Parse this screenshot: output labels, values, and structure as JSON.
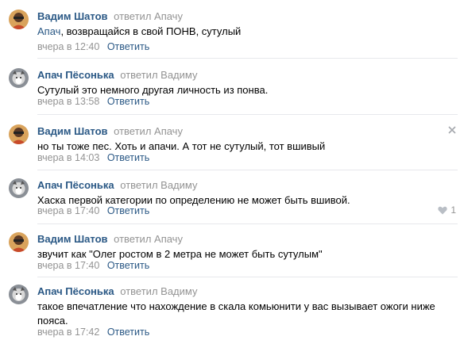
{
  "comments": [
    {
      "author": "Вадим Шатов",
      "replied": "ответил",
      "reply_to": "Апачу",
      "mention": "Апач",
      "text": ", возвращайся в свой ПОНВ, сутулый",
      "date": "вчера в 12:40",
      "reply_label": "Ответить",
      "avatar": "vadim-avatar"
    },
    {
      "author": "Апач Пёсонька",
      "replied": "ответил",
      "reply_to": "Вадиму",
      "text": "Сутулый это немного другая личность из понва.",
      "date": "вчера в 13:58",
      "reply_label": "Ответить",
      "avatar": "apach-avatar"
    },
    {
      "author": "Вадим Шатов",
      "replied": "ответил",
      "reply_to": "Апачу",
      "text": "но ты тоже пес. Хоть и апачи. А тот не сутулый, тот вшивый",
      "date": "вчера в 14:03",
      "reply_label": "Ответить",
      "avatar": "vadim-avatar",
      "close_icon": "close-icon"
    },
    {
      "author": "Апач Пёсонька",
      "replied": "ответил",
      "reply_to": "Вадиму",
      "text": "Хаска первой категории по определению не может быть вшивой.",
      "date": "вчера в 17:40",
      "reply_label": "Ответить",
      "avatar": "apach-avatar",
      "likes": "1"
    },
    {
      "author": "Вадим Шатов",
      "replied": "ответил",
      "reply_to": "Апачу",
      "text": "звучит как \"Олег ростом в 2 метра не может быть сутулым\"",
      "date": "вчера в 17:40",
      "reply_label": "Ответить",
      "avatar": "vadim-avatar"
    },
    {
      "author": "Апач Пёсонька",
      "replied": "ответил",
      "reply_to": "Вадиму",
      "text": "такое впечатление что нахождение в скала комьюнити у вас вызывает ожоги ниже пояса.",
      "date": "вчера в 17:42",
      "reply_label": "Ответить",
      "avatar": "apach-avatar"
    }
  ],
  "colors": {
    "link": "#2a5885",
    "muted": "#939393",
    "divider": "#e7e8ec"
  }
}
